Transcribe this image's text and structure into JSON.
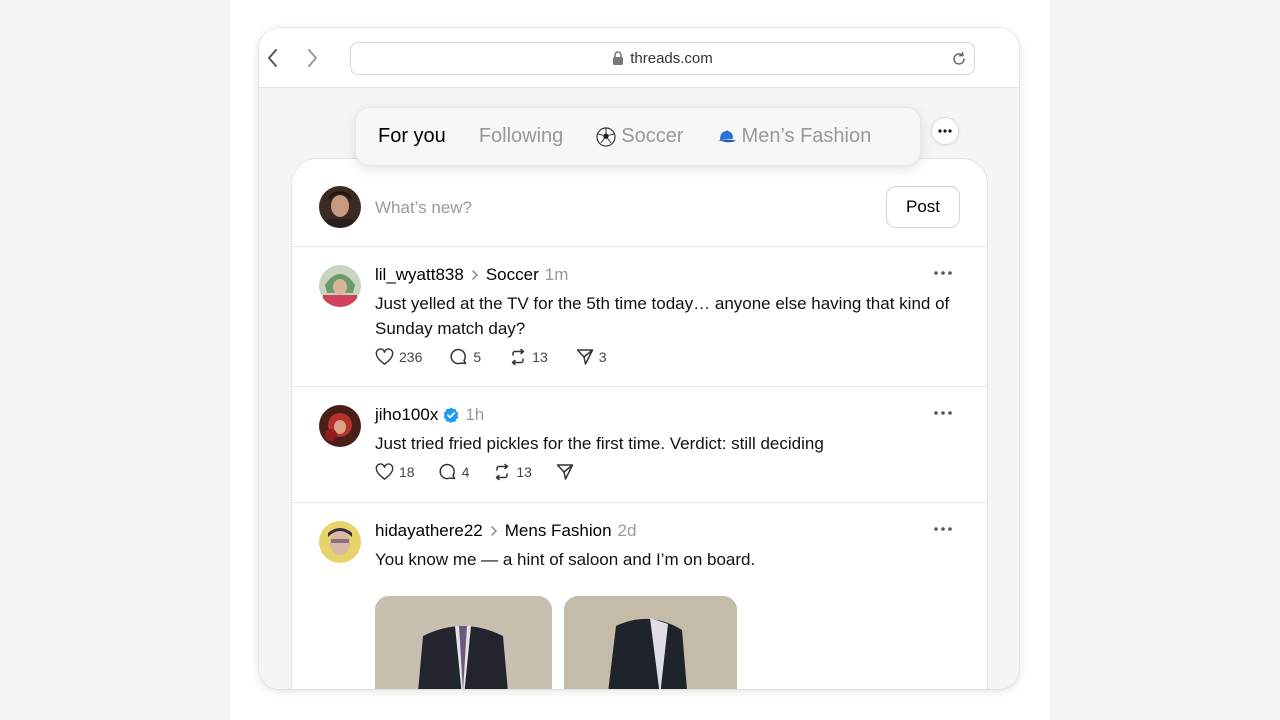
{
  "browser": {
    "url": "threads.com"
  },
  "tabs": [
    {
      "label": "For you",
      "emoji": ""
    },
    {
      "label": "Following",
      "emoji": ""
    },
    {
      "label": "Soccer",
      "emoji": "soccer-ball"
    },
    {
      "label": "Men’s Fashion",
      "emoji": "cap"
    }
  ],
  "composer": {
    "placeholder": "What’s new?",
    "post_label": "Post"
  },
  "posts": [
    {
      "username": "lil_wyatt838",
      "topic": "Soccer",
      "time": "1m",
      "text": "Just yelled at the TV for the 5th time today… anyone else having that kind of Sunday match day?",
      "likes": "236",
      "replies": "5",
      "reposts": "13",
      "shares": "3"
    },
    {
      "username": "jiho100x",
      "verified": true,
      "time": "1h",
      "text": "Just tried fried pickles for the first time. Verdict: still deciding",
      "likes": "18",
      "replies": "4",
      "reposts": "13",
      "shares": ""
    },
    {
      "username": "hidayathere22",
      "topic": "Mens Fashion",
      "time": "2d",
      "text": "You know me — a hint of saloon and I’m on board."
    }
  ],
  "colors": {
    "accent_verified": "#1d9bf0",
    "muted_text": "#9a9a9a"
  }
}
